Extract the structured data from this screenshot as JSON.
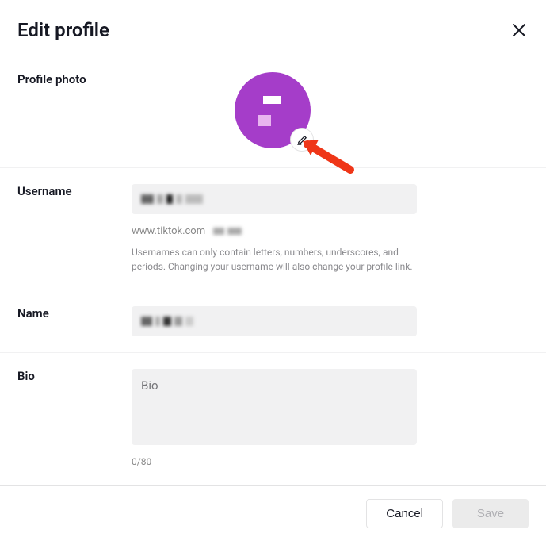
{
  "header": {
    "title": "Edit profile"
  },
  "photo": {
    "label": "Profile photo"
  },
  "username": {
    "label": "Username",
    "url_prefix": "www.tiktok.com",
    "helper": "Usernames can only contain letters, numbers, underscores, and periods. Changing your username will also change your profile link."
  },
  "name": {
    "label": "Name"
  },
  "bio": {
    "label": "Bio",
    "placeholder": "Bio",
    "counter": "0/80"
  },
  "footer": {
    "cancel": "Cancel",
    "save": "Save"
  }
}
